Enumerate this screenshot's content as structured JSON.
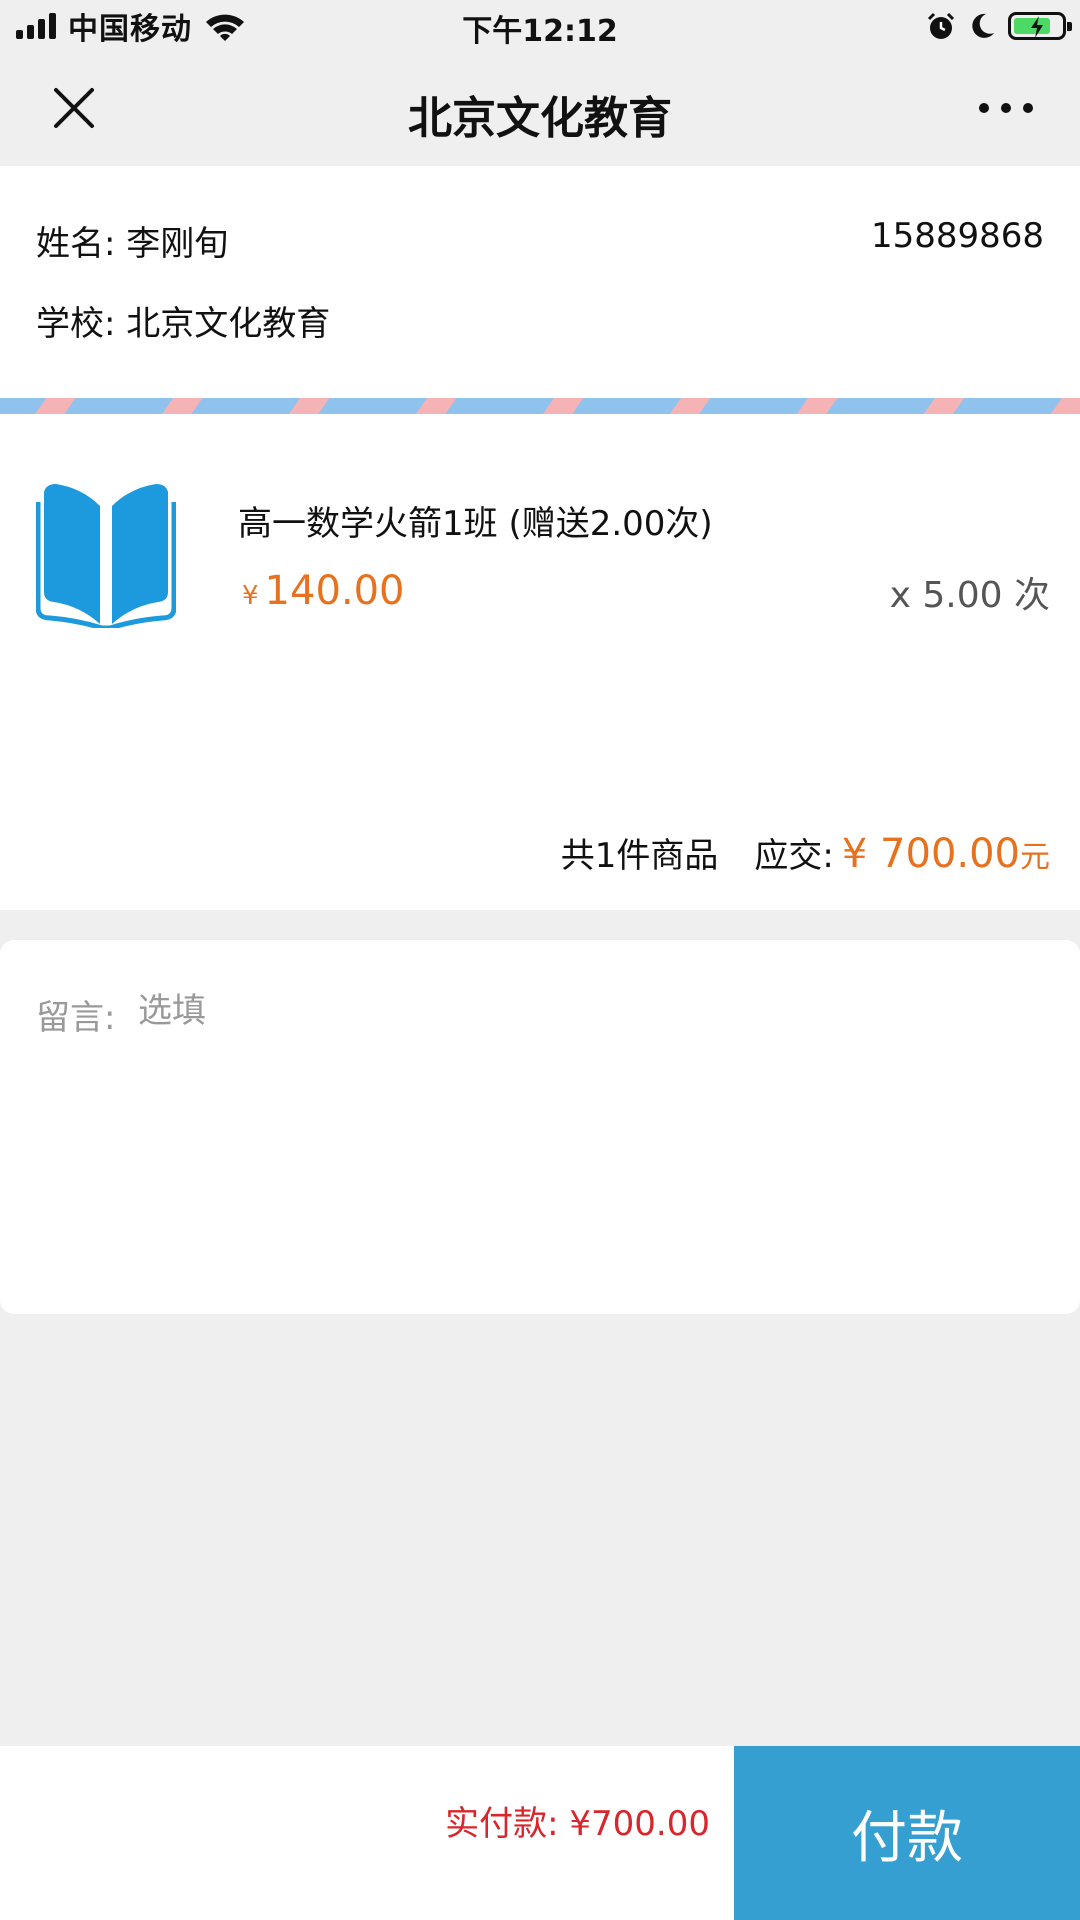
{
  "status_bar": {
    "carrier": "中国移动",
    "time": "下午12:12",
    "icons": [
      "signal-icon",
      "wifi-icon",
      "alarm-icon",
      "moon-icon",
      "battery-charging-icon"
    ]
  },
  "nav": {
    "title": "北京文化教育",
    "close_icon": "close-icon",
    "more_icon": "more-icon"
  },
  "contact": {
    "name_label": "姓名:",
    "name_value": "李刚旬",
    "phone": "15889868",
    "school_label": "学校:",
    "school_value": "北京文化教育"
  },
  "order": {
    "item": {
      "icon": "book-icon",
      "name": "高一数学火箭1班 (赠送2.00次)",
      "currency": "¥",
      "price": "140.00",
      "quantity": "x 5.00 次"
    },
    "count_text": "共1件商品",
    "due_label": "应交:",
    "due_amount": "¥ 700.00",
    "due_unit": "元"
  },
  "message": {
    "label": "留言:",
    "placeholder": "选填"
  },
  "footer": {
    "actual_label": "实付款:",
    "actual_amount": "¥700.00",
    "pay_button": "付款"
  },
  "colors": {
    "accent_orange": "#e8711d",
    "pay_blue": "#359fd1",
    "actual_red": "#d9252b",
    "book_blue": "#1d99dd"
  }
}
